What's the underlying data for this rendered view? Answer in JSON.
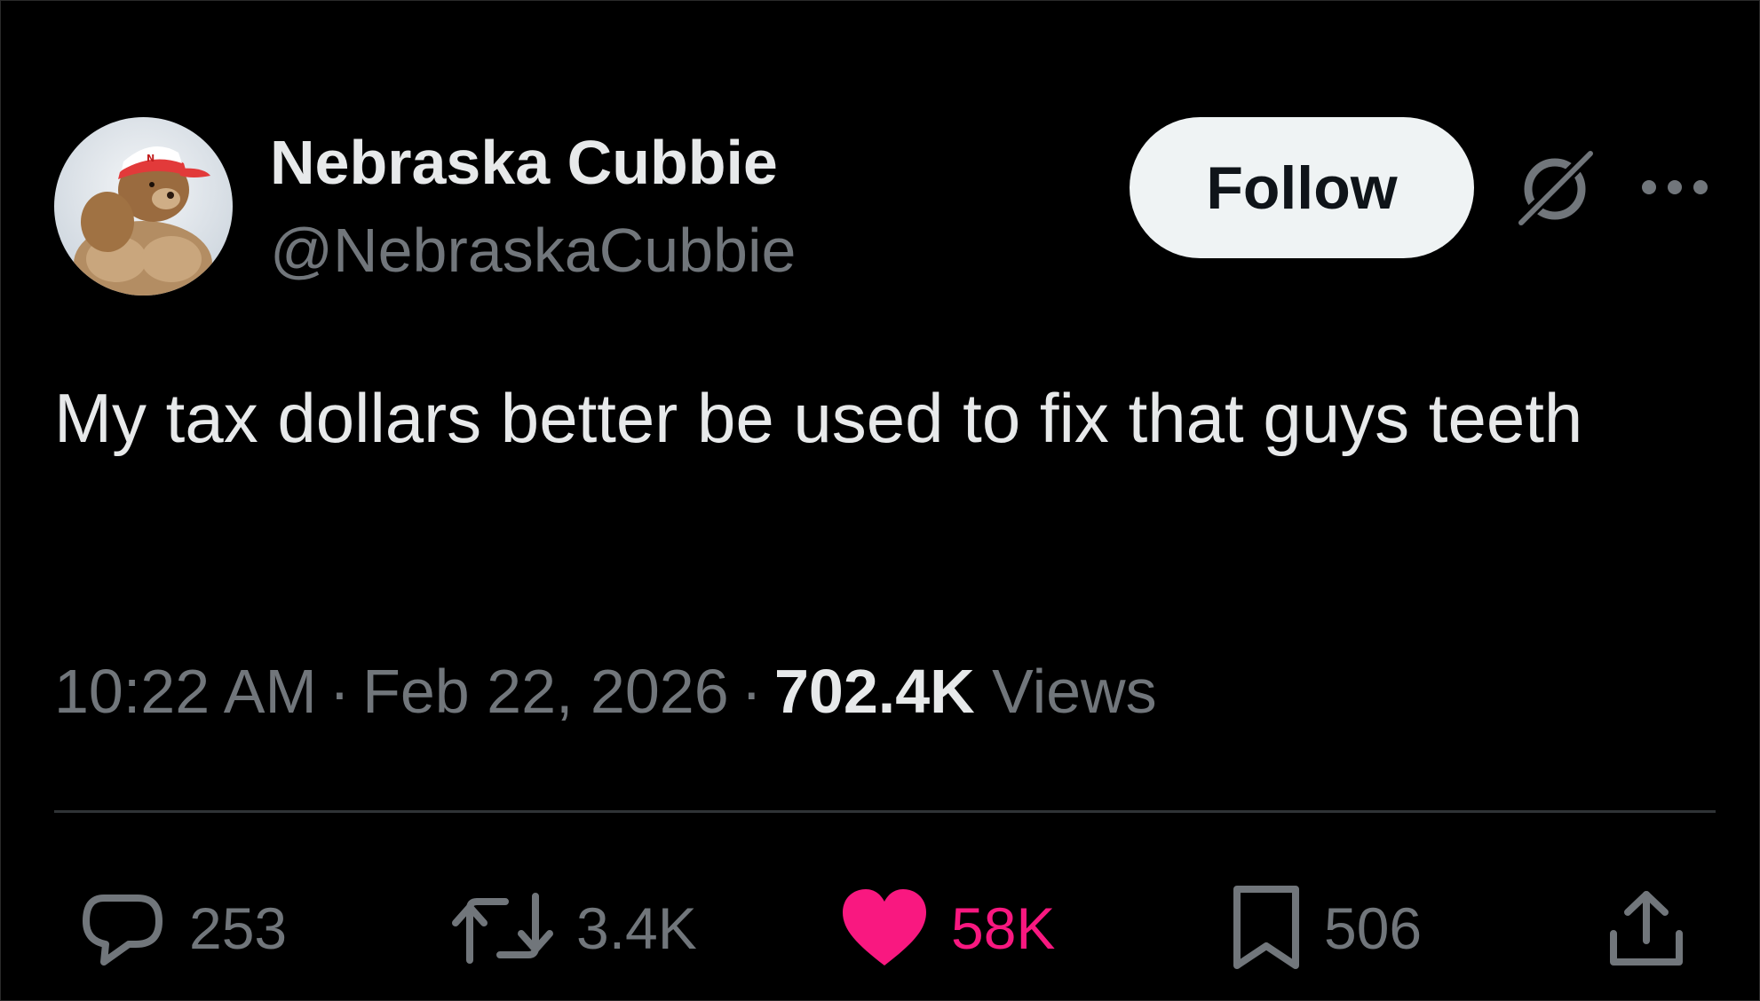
{
  "author": {
    "display_name": "Nebraska Cubbie",
    "handle": "@NebraskaCubbie",
    "avatar_icon": "bear-with-cap-avatar"
  },
  "header": {
    "follow_label": "Follow",
    "grok_icon": "grok-slash-circle-icon",
    "more_icon": "more-dots-icon"
  },
  "tweet": {
    "text": "My tax dollars better be used to fix that guys teeth",
    "time": "10:22 AM",
    "separator": "·",
    "date": "Feb 22, 2026",
    "views_count": "702.4K",
    "views_label": "Views"
  },
  "actions": {
    "replies": {
      "icon": "reply-bubble-icon",
      "count": "253"
    },
    "reposts": {
      "icon": "repost-icon",
      "count": "3.4K"
    },
    "likes": {
      "icon": "heart-filled-icon",
      "count": "58K",
      "active": true
    },
    "bookmarks": {
      "icon": "bookmark-icon",
      "count": "506"
    },
    "share": {
      "icon": "share-upload-icon"
    }
  },
  "colors": {
    "background": "#000000",
    "text_primary": "#e7e9ea",
    "text_secondary": "#71767b",
    "like_pink": "#f91880",
    "follow_button_bg": "#eff3f4",
    "divider": "#2f3336"
  }
}
